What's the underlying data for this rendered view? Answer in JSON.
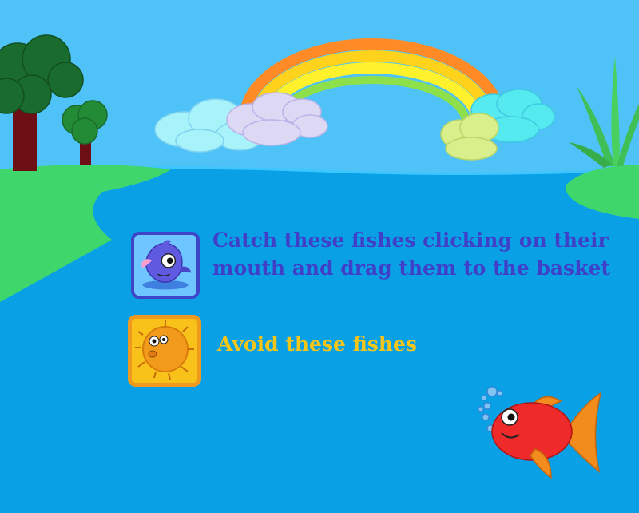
{
  "instructions": {
    "catch_text": "Catch these fishes clicking on their mouth and drag them to the basket",
    "avoid_text": "Avoid these fishes"
  },
  "icons": {
    "catch_fish": "blue-fish-icon",
    "avoid_fish": "pufferfish-icon",
    "mascot": "red-fish-icon"
  },
  "colors": {
    "sky": "#4fc3f7",
    "water": "#0aa0e6",
    "grass": "#3fd66b",
    "catch_text": "#3f3fc8",
    "avoid_text": "#f5c518",
    "catch_card_border": "#3f45c8",
    "avoid_card_border": "#ef9a1e"
  }
}
